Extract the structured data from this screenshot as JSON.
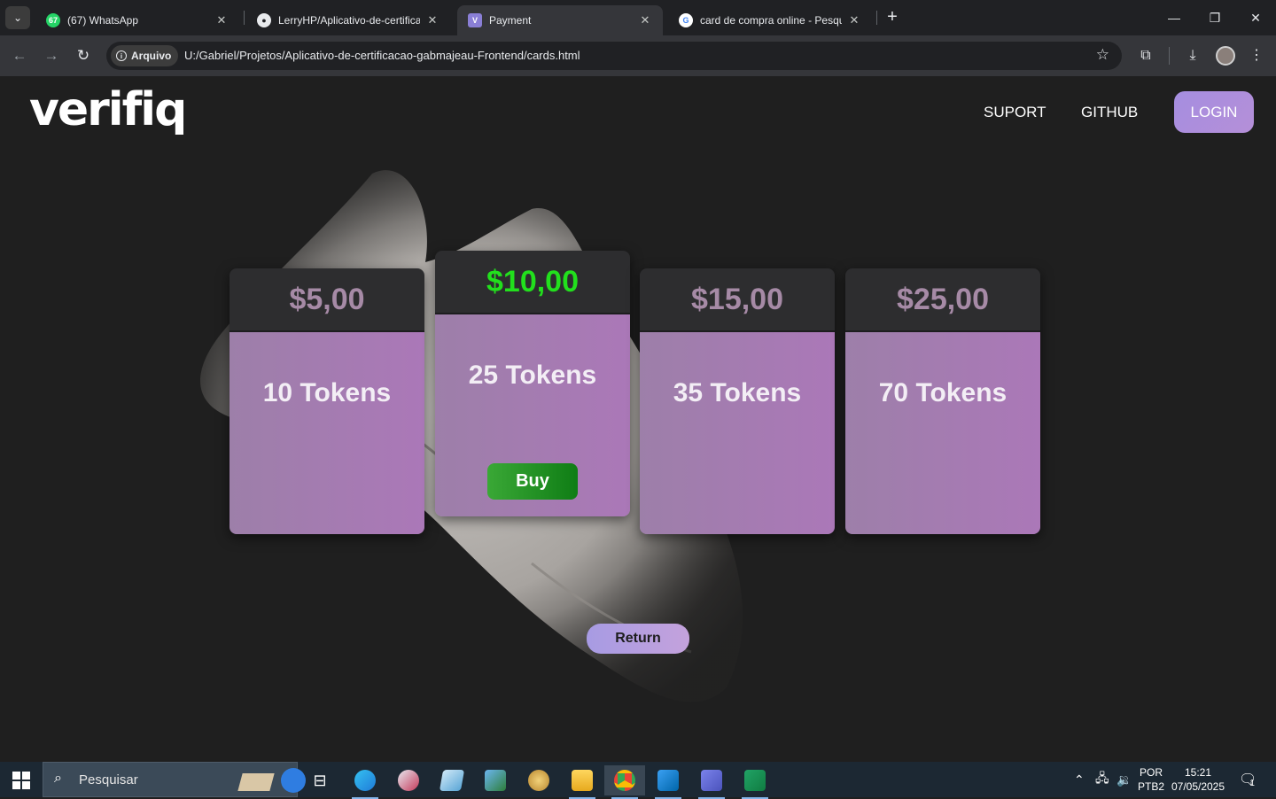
{
  "browser": {
    "tabs": [
      {
        "title": "(67) WhatsApp",
        "favicon": "whatsapp-icon",
        "badge": "67"
      },
      {
        "title": "LerryHP/Aplicativo-de-certificac",
        "favicon": "github-icon"
      },
      {
        "title": "Payment",
        "favicon": "v-icon",
        "glyph": "V"
      },
      {
        "title": "card de compra online - Pesquis",
        "favicon": "google-icon"
      }
    ],
    "address": {
      "chip_label": "Arquivo",
      "url": "U:/Gabriel/Projetos/Aplicativo-de-certificacao-gabmajeau-Frontend/cards.html"
    }
  },
  "header": {
    "logo": "verifiq",
    "nav": {
      "support": "SUPORT",
      "github": "GITHUB",
      "login": "LOGIN"
    }
  },
  "cards": [
    {
      "price": "$5,00",
      "tokens": "10 Tokens"
    },
    {
      "price": "$10,00",
      "tokens": "25 Tokens",
      "buy": "Buy"
    },
    {
      "price": "$15,00",
      "tokens": "35 Tokens"
    },
    {
      "price": "$25,00",
      "tokens": "70 Tokens"
    }
  ],
  "return_label": "Return",
  "colors": {
    "featured_price": "#22e01d",
    "price": "#a68aa6",
    "card_body": "#a67cb2",
    "buy": "#1f8f22",
    "login": "#ad90dc"
  },
  "taskbar": {
    "search_placeholder": "Pesquisar",
    "lang_line1": "POR",
    "lang_line2": "PTB2",
    "time": "15:21",
    "date": "07/05/2025",
    "notification_count": "1"
  }
}
